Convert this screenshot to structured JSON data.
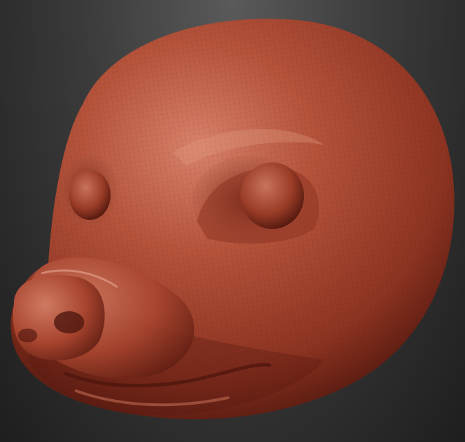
{
  "viewport": {
    "background_top": "#5a5a5a",
    "background_bottom": "#1e1e1e"
  },
  "sculpt": {
    "subject": "animal-head-sculpt",
    "material_color": "#a9452f",
    "material_highlight": "#d9826a",
    "material_shadow": "#4a140c",
    "wireframe_overlay": true
  }
}
